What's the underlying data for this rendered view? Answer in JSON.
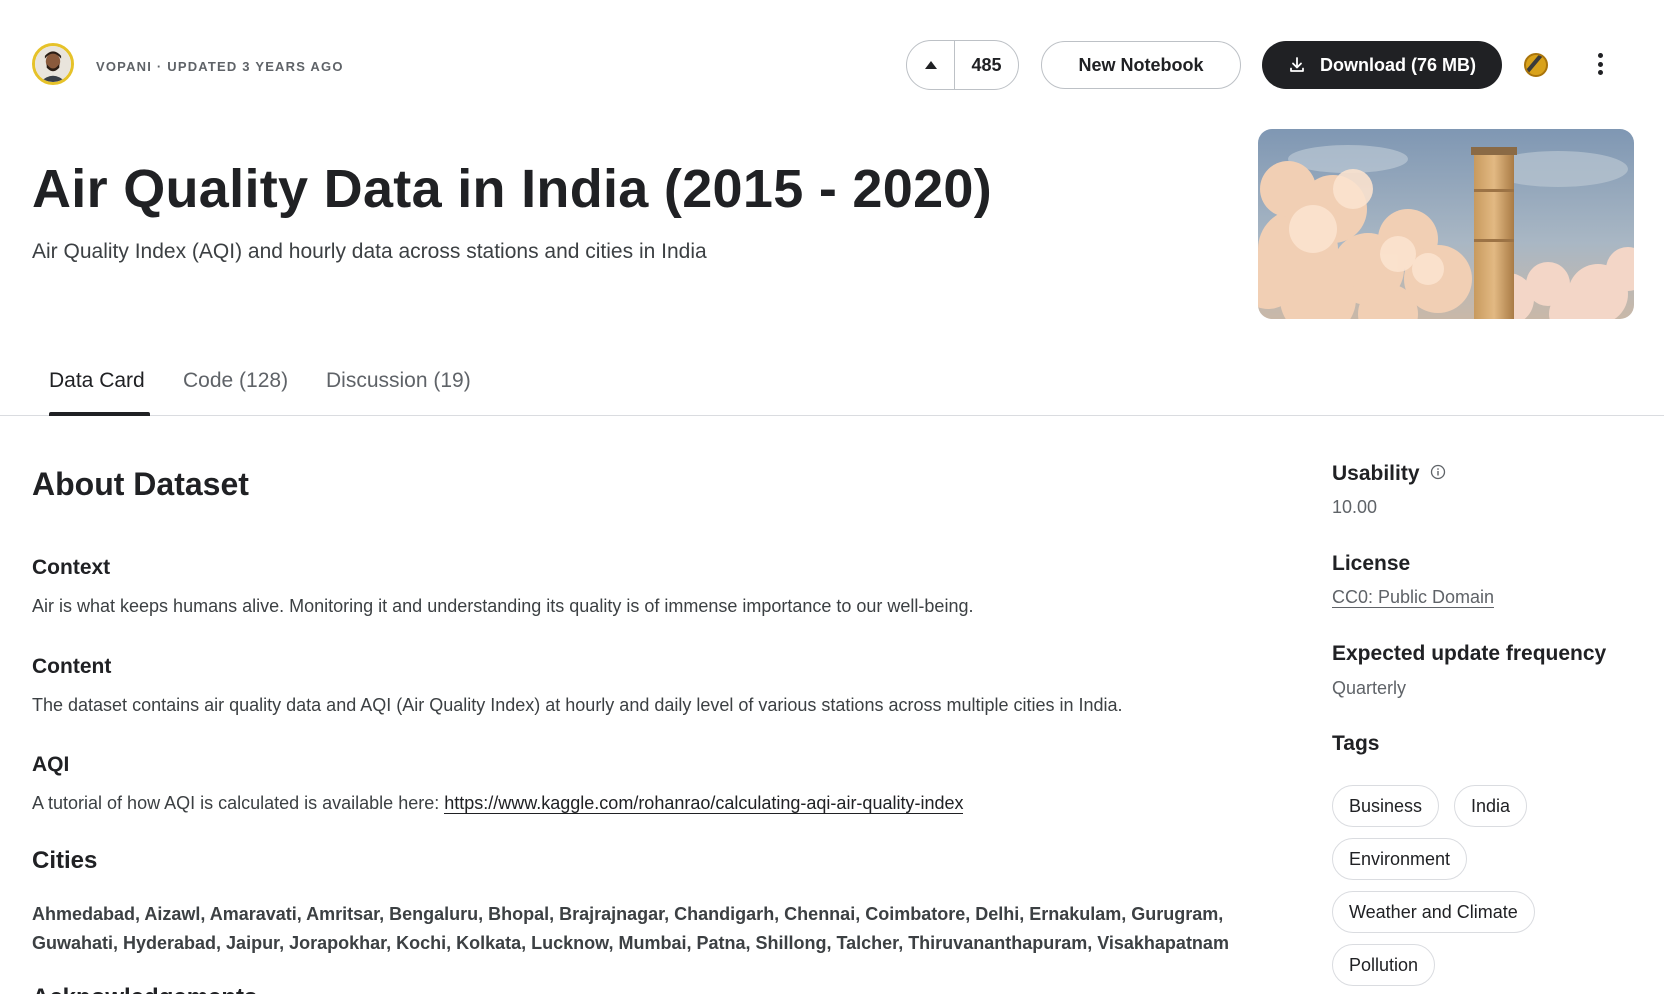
{
  "header": {
    "owner_line": "VOPANI · UPDATED 3 YEARS AGO",
    "vote_count": "485",
    "new_notebook_label": "New Notebook",
    "download_label": "Download (76 MB)"
  },
  "dataset": {
    "title": "Air Quality Data in India (2015 - 2020)",
    "subtitle": "Air Quality Index (AQI) and hourly data across stations and cities in India"
  },
  "tabs": [
    {
      "label": "Data Card",
      "active": true
    },
    {
      "label": "Code (128)",
      "active": false
    },
    {
      "label": "Discussion (19)",
      "active": false
    }
  ],
  "about": {
    "heading": "About Dataset",
    "context_heading": "Context",
    "context_text": "Air is what keeps humans alive. Monitoring it and understanding its quality is of immense importance to our well-being.",
    "content_heading": "Content",
    "content_text": "The dataset contains air quality data and AQI (Air Quality Index) at hourly and daily level of various stations across multiple cities in India.",
    "aqi_heading": "AQI",
    "aqi_text": "A tutorial of how AQI is calculated is available here: ",
    "aqi_link": "https://www.kaggle.com/rohanrao/calculating-aqi-air-quality-index",
    "cities_heading": "Cities",
    "cities_text": "Ahmedabad, Aizawl, Amaravati, Amritsar, Bengaluru, Bhopal, Brajrajnagar, Chandigarh, Chennai, Coimbatore, Delhi, Ernakulam, Gurugram, Guwahati, Hyderabad, Jaipur, Jorapokhar, Kochi, Kolkata, Lucknow, Mumbai, Patna, Shillong, Talcher, Thiruvananthapuram, Visakhapatnam",
    "next_heading": "Acknowledgements"
  },
  "sidebar": {
    "usability_label": "Usability",
    "usability_value": "10.00",
    "license_label": "License",
    "license_value": "CC0: Public Domain",
    "frequency_label": "Expected update frequency",
    "frequency_value": "Quarterly",
    "tags_label": "Tags",
    "tags": [
      "Business",
      "India",
      "Environment",
      "Weather and Climate",
      "Pollution"
    ]
  },
  "colors": {
    "primary_dark": "#202124",
    "secondary_text": "#5f6368",
    "border": "#dadce0",
    "avatar_ring": "#e6c229",
    "medal": "#d9a21b"
  },
  "icons": {
    "vote": "caret-up-icon",
    "download": "download-icon",
    "medal": "medal-icon",
    "menu": "more-vertical-icon",
    "info": "info-icon"
  }
}
